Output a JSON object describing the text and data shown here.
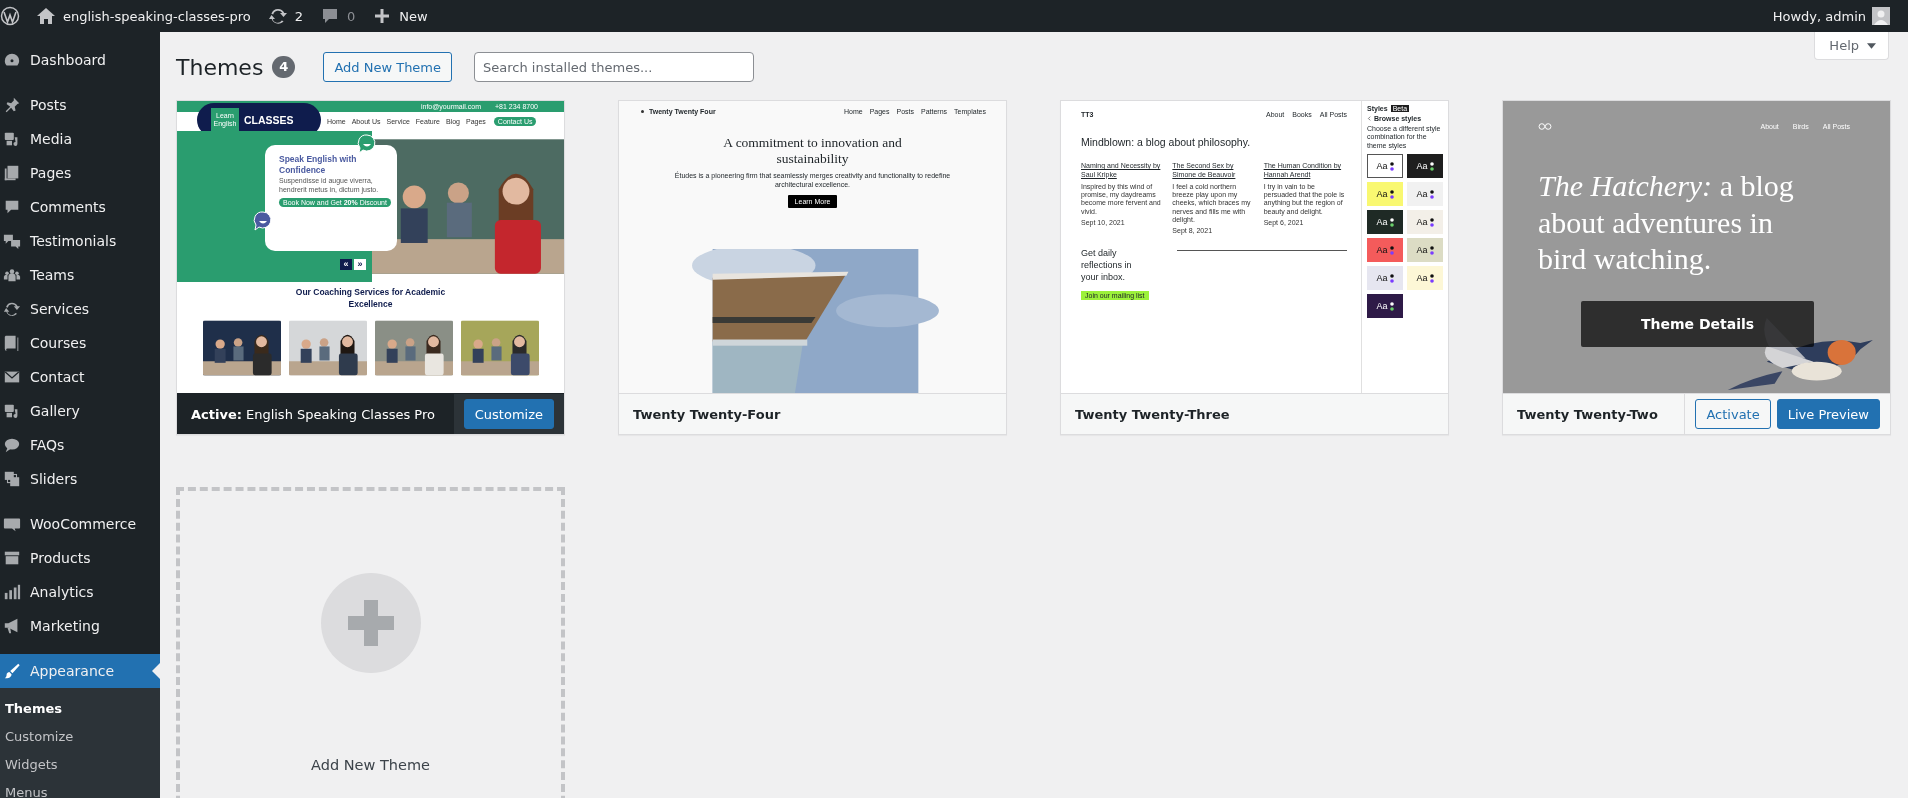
{
  "admin_bar": {
    "site_name": "english-speaking-classes-pro",
    "updates": "2",
    "comments": "0",
    "new_label": "New",
    "greeting": "Howdy, admin"
  },
  "sidebar": {
    "groups": [
      [
        {
          "label": "Dashboard",
          "selected": false
        }
      ],
      [
        {
          "label": "Posts",
          "selected": false
        },
        {
          "label": "Media",
          "selected": false
        },
        {
          "label": "Pages",
          "selected": false
        },
        {
          "label": "Comments",
          "selected": false
        },
        {
          "label": "Testimonials",
          "selected": false
        },
        {
          "label": "Teams",
          "selected": false
        },
        {
          "label": "Services",
          "selected": false
        },
        {
          "label": "Courses",
          "selected": false
        },
        {
          "label": "Contact",
          "selected": false
        },
        {
          "label": "Gallery",
          "selected": false
        },
        {
          "label": "FAQs",
          "selected": false
        },
        {
          "label": "Sliders",
          "selected": false
        }
      ],
      [
        {
          "label": "WooCommerce",
          "selected": false
        },
        {
          "label": "Products",
          "selected": false
        },
        {
          "label": "Analytics",
          "selected": false
        },
        {
          "label": "Marketing",
          "selected": false
        }
      ],
      [
        {
          "label": "Appearance",
          "selected": true,
          "children": [
            {
              "label": "Themes",
              "selected": true
            },
            {
              "label": "Customize",
              "selected": false
            },
            {
              "label": "Widgets",
              "selected": false
            },
            {
              "label": "Menus",
              "selected": false
            }
          ]
        }
      ]
    ]
  },
  "help_button": "Help",
  "header": {
    "title": "Themes",
    "count": "4",
    "add_button": "Add New Theme",
    "search": {
      "placeholder": "Search installed themes..."
    }
  },
  "themes": [
    {
      "name": "English Speaking Classes Pro",
      "active": true,
      "active_label": "Active:",
      "hovered": false,
      "actions": [
        {
          "label": "Customize",
          "kind": "primary"
        }
      ],
      "preview": {
        "kind": "classes",
        "topbar": [
          "info@yourmail.com",
          "+81 234 8700"
        ],
        "logo_badge": "Learn English",
        "logo_text": "CLASSES",
        "nav": [
          "Home",
          "About Us",
          "Service",
          "Feature",
          "Blog",
          "Pages"
        ],
        "nav_button": "Contact Us",
        "hero_title": "Speak English with Confidence",
        "hero_text": "Suspendisse id augue viverra, hendrerit metus in, dictum justo.",
        "hero_button": "Book Now and Get **20%** Discount",
        "prev": "«",
        "next": "»",
        "section_title": "Our Coaching Services for Academic Excellence"
      }
    },
    {
      "name": "Twenty Twenty-Four",
      "active": false,
      "hovered": false,
      "preview": {
        "kind": "tt4",
        "site_title": "Twenty Twenty Four",
        "nav": [
          "Home",
          "Pages",
          "Posts",
          "Patterns",
          "Templates"
        ],
        "heading": "A commitment to innovation and sustainability",
        "text": "Études is a pioneering firm that seamlessly merges creativity and functionality to redefine architectural excellence.",
        "button": "Learn More"
      }
    },
    {
      "name": "Twenty Twenty-Three",
      "active": false,
      "hovered": false,
      "preview": {
        "kind": "tt3",
        "site_title": "TT3",
        "nav": [
          "About",
          "Books",
          "All Posts"
        ],
        "heading": "Mindblown: a blog about philosophy.",
        "posts": [
          {
            "title": "Naming and Necessity by Saul Kripke",
            "excerpt": "Inspired by this wind of promise, my daydreams become more fervent and vivid.",
            "date": "Sept 10, 2021"
          },
          {
            "title": "The Second Sex by Simone de Beauvoir",
            "excerpt": "I feel a cold northern breeze play upon my cheeks, which braces my nerves and fills me with delight.",
            "date": "Sept 8, 2021"
          },
          {
            "title": "The Human Condition by Hannah Arendt",
            "excerpt": "I try in vain to be persuaded that the pole is anything but the region of beauty and delight.",
            "date": "Sept 6, 2021"
          }
        ],
        "cta": "Get daily reflections in your inbox.",
        "cta_button": "Join our mailing list",
        "panel": {
          "title": "Styles",
          "badge": "Beta",
          "back": "Browse styles",
          "description": "Choose a different style combination for the theme styles",
          "swatches": [
            {
              "label": "Aa",
              "color": "#ffffff",
              "selected": true
            },
            {
              "label": "Aa",
              "color": "#1e1e1e",
              "selected": false
            },
            {
              "label": "Aa",
              "color": "#f9f871",
              "selected": false
            },
            {
              "label": "Aa",
              "color": "#f1f1f1",
              "selected": false
            },
            {
              "label": "Aa",
              "color": "#1f2a25",
              "selected": false
            },
            {
              "label": "Aa",
              "color": "#f3efe8",
              "selected": false
            },
            {
              "label": "Aa",
              "color": "#f45b5b",
              "selected": false
            },
            {
              "label": "Aa",
              "color": "#dcdcc4",
              "selected": false
            },
            {
              "label": "Aa",
              "color": "#e6e6f0",
              "selected": false
            },
            {
              "label": "Aa",
              "color": "#fdf7d6",
              "selected": false
            },
            {
              "label": "Aa",
              "color": "#2e1a47",
              "selected": false
            }
          ]
        }
      }
    },
    {
      "name": "Twenty Twenty-Two",
      "active": false,
      "hovered": true,
      "overlay_label": "Theme Details",
      "actions": [
        {
          "label": "Activate",
          "kind": "secondary"
        },
        {
          "label": "Live Preview",
          "kind": "primary"
        }
      ],
      "preview": {
        "kind": "tt2",
        "nav": [
          "About",
          "Birds",
          "All Posts"
        ],
        "heading": "*The Hatchery:* a blog about adventures in bird watching."
      }
    }
  ],
  "add_new_card": {
    "label": "Add New Theme"
  }
}
